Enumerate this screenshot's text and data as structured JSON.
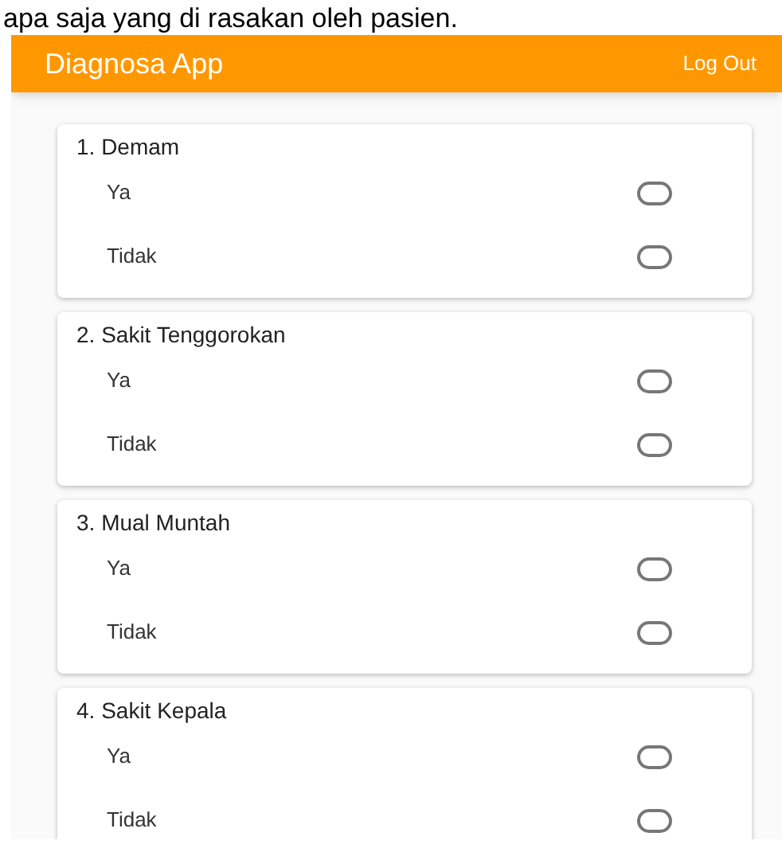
{
  "caption": "apa saja yang di rasakan oleh pasien.",
  "app_bar": {
    "title": "Diagnosa App",
    "action": "Log Out"
  },
  "questions": [
    {
      "title": "1. Demam",
      "options": [
        {
          "label": "Ya",
          "selected": false
        },
        {
          "label": "Tidak",
          "selected": false
        }
      ]
    },
    {
      "title": "2. Sakit Tenggorokan",
      "options": [
        {
          "label": "Ya",
          "selected": false
        },
        {
          "label": "Tidak",
          "selected": false
        }
      ]
    },
    {
      "title": "3. Mual Muntah",
      "options": [
        {
          "label": "Ya",
          "selected": false
        },
        {
          "label": "Tidak",
          "selected": false
        }
      ]
    },
    {
      "title": "4. Sakit Kepala",
      "options": [
        {
          "label": "Ya",
          "selected": false
        },
        {
          "label": "Tidak",
          "selected": false
        }
      ]
    }
  ]
}
